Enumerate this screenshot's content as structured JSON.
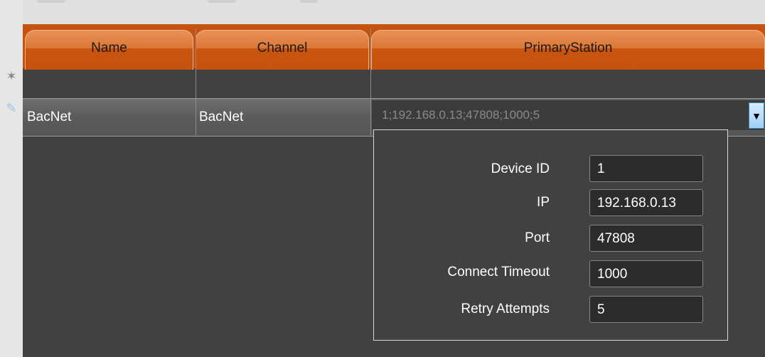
{
  "columns": {
    "name": "Name",
    "channel": "Channel",
    "primary_station": "PrimaryStation"
  },
  "row_indicators": {
    "new_row": "✶",
    "edit_row": "✎"
  },
  "row": {
    "name": "BacNet",
    "channel": "BacNet",
    "primary_station": "1;192.168.0.13;47808;1000;5"
  },
  "combo": {
    "dropdown_glyph": "▼"
  },
  "station_editor": {
    "fields": [
      {
        "label": "Device ID",
        "value": "1"
      },
      {
        "label": "IP",
        "value": "192.168.0.13"
      },
      {
        "label": "Port",
        "value": "47808"
      },
      {
        "label": "Connect Timeout",
        "value": "1000"
      },
      {
        "label": "Retry Attempts",
        "value": "5"
      }
    ]
  }
}
